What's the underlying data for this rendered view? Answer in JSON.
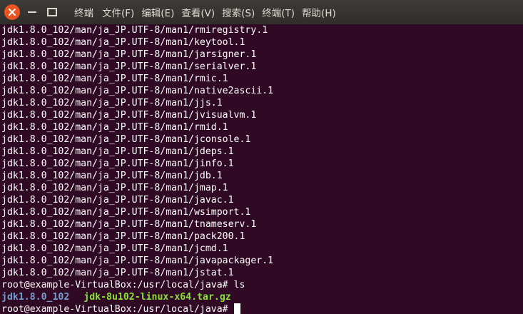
{
  "window": {
    "title": "终端"
  },
  "menu": {
    "items": [
      "文件(F)",
      "编辑(E)",
      "查看(V)",
      "搜索(S)",
      "终端(T)",
      "帮助(H)"
    ]
  },
  "terminal": {
    "output_lines": [
      "jdk1.8.0_102/man/ja_JP.UTF-8/man1/rmiregistry.1",
      "jdk1.8.0_102/man/ja_JP.UTF-8/man1/keytool.1",
      "jdk1.8.0_102/man/ja_JP.UTF-8/man1/jarsigner.1",
      "jdk1.8.0_102/man/ja_JP.UTF-8/man1/serialver.1",
      "jdk1.8.0_102/man/ja_JP.UTF-8/man1/rmic.1",
      "jdk1.8.0_102/man/ja_JP.UTF-8/man1/native2ascii.1",
      "jdk1.8.0_102/man/ja_JP.UTF-8/man1/jjs.1",
      "jdk1.8.0_102/man/ja_JP.UTF-8/man1/jvisualvm.1",
      "jdk1.8.0_102/man/ja_JP.UTF-8/man1/rmid.1",
      "jdk1.8.0_102/man/ja_JP.UTF-8/man1/jconsole.1",
      "jdk1.8.0_102/man/ja_JP.UTF-8/man1/jdeps.1",
      "jdk1.8.0_102/man/ja_JP.UTF-8/man1/jinfo.1",
      "jdk1.8.0_102/man/ja_JP.UTF-8/man1/jdb.1",
      "jdk1.8.0_102/man/ja_JP.UTF-8/man1/jmap.1",
      "jdk1.8.0_102/man/ja_JP.UTF-8/man1/javac.1",
      "jdk1.8.0_102/man/ja_JP.UTF-8/man1/wsimport.1",
      "jdk1.8.0_102/man/ja_JP.UTF-8/man1/tnameserv.1",
      "jdk1.8.0_102/man/ja_JP.UTF-8/man1/pack200.1",
      "jdk1.8.0_102/man/ja_JP.UTF-8/man1/jcmd.1",
      "jdk1.8.0_102/man/ja_JP.UTF-8/man1/javapackager.1",
      "jdk1.8.0_102/man/ja_JP.UTF-8/man1/jstat.1"
    ],
    "ls_command_line": "root@example-VirtualBox:/usr/local/java# ls",
    "ls_result": {
      "directory": "jdk1.8.0_102",
      "archive": "jdk-8u102-linux-x64.tar.gz"
    },
    "prompt": "root@example-VirtualBox:/usr/local/java#"
  },
  "colors": {
    "background": "#300a24",
    "titlebar": "#3c3b37",
    "close_button": "#e95420",
    "text": "#ffffff",
    "directory": "#729fcf",
    "archive": "#8ae234"
  },
  "icons": {
    "close": "close-icon",
    "minimize": "minimize-icon",
    "maximize": "maximize-icon"
  }
}
